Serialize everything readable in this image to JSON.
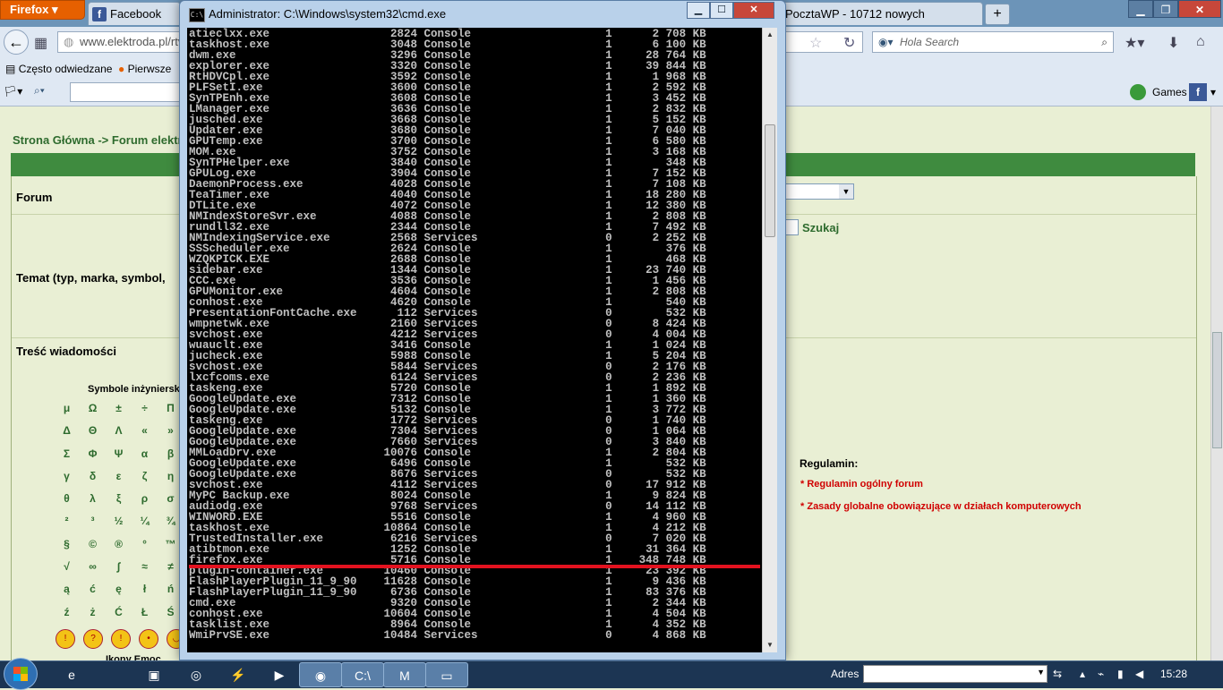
{
  "firefox": {
    "menu_button": "Firefox",
    "tabs": [
      {
        "label": "Facebook",
        "icon": "facebook-icon"
      },
      {
        "label": "PocztaWP - 10712 nowych",
        "icon": "mail-icon"
      }
    ],
    "new_tab": "+",
    "url": "www.elektroda.pl/rtv",
    "search_placeholder": "Hola Search",
    "bookmarks": [
      {
        "label": "Często odwiedzane"
      },
      {
        "label": "Pierwsze"
      }
    ],
    "games_label": "Games"
  },
  "page": {
    "breadcrumb": "Strona Główna -> Forum elektroda",
    "labels": {
      "forum": "Forum",
      "temat": "Temat (typ, marka, symbol,",
      "tresc": "Treść wiadomości",
      "symbols_title": "Symbole inżynierskie",
      "ikony": "Ikony Emoc"
    },
    "search_button": "Szukaj",
    "symbols": [
      "μ",
      "Ω",
      "±",
      "÷",
      "Π",
      "Δ",
      "Θ",
      "Λ",
      "«",
      "»",
      "Σ",
      "Φ",
      "Ψ",
      "α",
      "β",
      "γ",
      "δ",
      "ε",
      "ζ",
      "η",
      "θ",
      "λ",
      "ξ",
      "ρ",
      "σ",
      "²",
      "³",
      "½",
      "¼",
      "¾",
      "§",
      "©",
      "®",
      "°",
      "™",
      "√",
      "∞",
      "∫",
      "≈",
      "≠",
      "ą",
      "ć",
      "ę",
      "ł",
      "ń",
      "ź",
      "ż",
      "Ć",
      "Ł",
      "Ś"
    ],
    "regulamin": {
      "title": "Regulamin:",
      "links": [
        "Regulamin ogólny forum",
        "Zasady globalne obowiązujące w działach komputerowych"
      ]
    }
  },
  "cmd": {
    "title": "Administrator: C:\\Windows\\system32\\cmd.exe",
    "processes": [
      {
        "name": "atieclxx.exe",
        "pid": "2824",
        "session": "Console",
        "num": "1",
        "mem": "2 708 KB"
      },
      {
        "name": "taskhost.exe",
        "pid": "3048",
        "session": "Console",
        "num": "1",
        "mem": "6 100 KB"
      },
      {
        "name": "dwm.exe",
        "pid": "3296",
        "session": "Console",
        "num": "1",
        "mem": "28 764 KB"
      },
      {
        "name": "explorer.exe",
        "pid": "3320",
        "session": "Console",
        "num": "1",
        "mem": "39 844 KB"
      },
      {
        "name": "RtHDVCpl.exe",
        "pid": "3592",
        "session": "Console",
        "num": "1",
        "mem": "1 968 KB"
      },
      {
        "name": "PLFSetI.exe",
        "pid": "3600",
        "session": "Console",
        "num": "1",
        "mem": "2 592 KB"
      },
      {
        "name": "SynTPEnh.exe",
        "pid": "3608",
        "session": "Console",
        "num": "1",
        "mem": "3 452 KB"
      },
      {
        "name": "LManager.exe",
        "pid": "3636",
        "session": "Console",
        "num": "1",
        "mem": "2 832 KB"
      },
      {
        "name": "jusched.exe",
        "pid": "3668",
        "session": "Console",
        "num": "1",
        "mem": "5 152 KB"
      },
      {
        "name": "Updater.exe",
        "pid": "3680",
        "session": "Console",
        "num": "1",
        "mem": "7 040 KB"
      },
      {
        "name": "GPUTemp.exe",
        "pid": "3700",
        "session": "Console",
        "num": "1",
        "mem": "6 580 KB"
      },
      {
        "name": "MOM.exe",
        "pid": "3752",
        "session": "Console",
        "num": "1",
        "mem": "3 168 KB"
      },
      {
        "name": "SynTPHelper.exe",
        "pid": "3840",
        "session": "Console",
        "num": "1",
        "mem": "348 KB"
      },
      {
        "name": "GPULog.exe",
        "pid": "3904",
        "session": "Console",
        "num": "1",
        "mem": "7 152 KB"
      },
      {
        "name": "DaemonProcess.exe",
        "pid": "4028",
        "session": "Console",
        "num": "1",
        "mem": "7 108 KB"
      },
      {
        "name": "TeaTimer.exe",
        "pid": "4040",
        "session": "Console",
        "num": "1",
        "mem": "18 280 KB"
      },
      {
        "name": "DTLite.exe",
        "pid": "4072",
        "session": "Console",
        "num": "1",
        "mem": "12 380 KB"
      },
      {
        "name": "NMIndexStoreSvr.exe",
        "pid": "4088",
        "session": "Console",
        "num": "1",
        "mem": "2 808 KB"
      },
      {
        "name": "rundll32.exe",
        "pid": "2344",
        "session": "Console",
        "num": "1",
        "mem": "7 492 KB"
      },
      {
        "name": "NMIndexingService.exe",
        "pid": "2568",
        "session": "Services",
        "num": "0",
        "mem": "2 252 KB"
      },
      {
        "name": "SSScheduler.exe",
        "pid": "2624",
        "session": "Console",
        "num": "1",
        "mem": "376 KB"
      },
      {
        "name": "WZQKPICK.EXE",
        "pid": "2688",
        "session": "Console",
        "num": "1",
        "mem": "468 KB"
      },
      {
        "name": "sidebar.exe",
        "pid": "1344",
        "session": "Console",
        "num": "1",
        "mem": "23 740 KB"
      },
      {
        "name": "CCC.exe",
        "pid": "3536",
        "session": "Console",
        "num": "1",
        "mem": "1 456 KB"
      },
      {
        "name": "GPUMonitor.exe",
        "pid": "4604",
        "session": "Console",
        "num": "1",
        "mem": "2 808 KB"
      },
      {
        "name": "conhost.exe",
        "pid": "4620",
        "session": "Console",
        "num": "1",
        "mem": "540 KB"
      },
      {
        "name": "PresentationFontCache.exe",
        "pid": "112",
        "session": "Services",
        "num": "0",
        "mem": "532 KB"
      },
      {
        "name": "wmpnetwk.exe",
        "pid": "2160",
        "session": "Services",
        "num": "0",
        "mem": "8 424 KB"
      },
      {
        "name": "svchost.exe",
        "pid": "4212",
        "session": "Services",
        "num": "0",
        "mem": "4 004 KB"
      },
      {
        "name": "wuauclt.exe",
        "pid": "3416",
        "session": "Console",
        "num": "1",
        "mem": "1 024 KB"
      },
      {
        "name": "jucheck.exe",
        "pid": "5988",
        "session": "Console",
        "num": "1",
        "mem": "5 204 KB"
      },
      {
        "name": "svchost.exe",
        "pid": "5844",
        "session": "Services",
        "num": "0",
        "mem": "2 176 KB"
      },
      {
        "name": "lxcfcoms.exe",
        "pid": "6124",
        "session": "Services",
        "num": "0",
        "mem": "2 236 KB"
      },
      {
        "name": "taskeng.exe",
        "pid": "5720",
        "session": "Console",
        "num": "1",
        "mem": "1 892 KB"
      },
      {
        "name": "GoogleUpdate.exe",
        "pid": "7312",
        "session": "Console",
        "num": "1",
        "mem": "1 360 KB"
      },
      {
        "name": "GoogleUpdate.exe",
        "pid": "5132",
        "session": "Console",
        "num": "1",
        "mem": "3 772 KB"
      },
      {
        "name": "taskeng.exe",
        "pid": "1772",
        "session": "Services",
        "num": "0",
        "mem": "1 740 KB"
      },
      {
        "name": "GoogleUpdate.exe",
        "pid": "7304",
        "session": "Services",
        "num": "0",
        "mem": "1 064 KB"
      },
      {
        "name": "GoogleUpdate.exe",
        "pid": "7660",
        "session": "Services",
        "num": "0",
        "mem": "3 840 KB"
      },
      {
        "name": "MMLoadDrv.exe",
        "pid": "10076",
        "session": "Console",
        "num": "1",
        "mem": "2 804 KB"
      },
      {
        "name": "GoogleUpdate.exe",
        "pid": "6496",
        "session": "Console",
        "num": "1",
        "mem": "532 KB"
      },
      {
        "name": "GoogleUpdate.exe",
        "pid": "8676",
        "session": "Services",
        "num": "0",
        "mem": "532 KB"
      },
      {
        "name": "svchost.exe",
        "pid": "4112",
        "session": "Services",
        "num": "0",
        "mem": "17 912 KB"
      },
      {
        "name": "MyPC Backup.exe",
        "pid": "8024",
        "session": "Console",
        "num": "1",
        "mem": "9 824 KB"
      },
      {
        "name": "audiodg.exe",
        "pid": "9768",
        "session": "Services",
        "num": "0",
        "mem": "14 112 KB"
      },
      {
        "name": "WINWORD.EXE",
        "pid": "5516",
        "session": "Console",
        "num": "1",
        "mem": "4 960 KB"
      },
      {
        "name": "taskhost.exe",
        "pid": "10864",
        "session": "Console",
        "num": "1",
        "mem": "4 212 KB"
      },
      {
        "name": "TrustedInstaller.exe",
        "pid": "6216",
        "session": "Services",
        "num": "0",
        "mem": "7 020 KB"
      },
      {
        "name": "atibtmon.exe",
        "pid": "1252",
        "session": "Console",
        "num": "1",
        "mem": "31 364 KB"
      },
      {
        "name": "firefox.exe",
        "pid": "5716",
        "session": "Console",
        "num": "1",
        "mem": "348 748 KB"
      },
      {
        "name": "plugin-container.exe",
        "pid": "10460",
        "session": "Console",
        "num": "1",
        "mem": "23 392 KB"
      },
      {
        "name": "FlashPlayerPlugin_11_9_90",
        "pid": "11628",
        "session": "Console",
        "num": "1",
        "mem": "9 436 KB"
      },
      {
        "name": "FlashPlayerPlugin_11_9_90",
        "pid": "6736",
        "session": "Console",
        "num": "1",
        "mem": "83 376 KB"
      },
      {
        "name": "cmd.exe",
        "pid": "9320",
        "session": "Console",
        "num": "1",
        "mem": "2 344 KB"
      },
      {
        "name": "conhost.exe",
        "pid": "10604",
        "session": "Console",
        "num": "1",
        "mem": "4 504 KB"
      },
      {
        "name": "tasklist.exe",
        "pid": "8964",
        "session": "Console",
        "num": "1",
        "mem": "4 352 KB"
      },
      {
        "name": "WmiPrvSE.exe",
        "pid": "10484",
        "session": "Services",
        "num": "0",
        "mem": "4 868 KB"
      }
    ],
    "highlight_color": "#e3121f"
  },
  "taskbar": {
    "adres_label": "Adres",
    "clock": "15:28",
    "apps": [
      "ie-icon",
      "save-disk-icon",
      "chrome-icon",
      "flash-icon",
      "media-player-icon",
      "firefox-icon",
      "cmd-icon",
      "malwarebytes-icon",
      "remote-desktop-icon"
    ]
  }
}
